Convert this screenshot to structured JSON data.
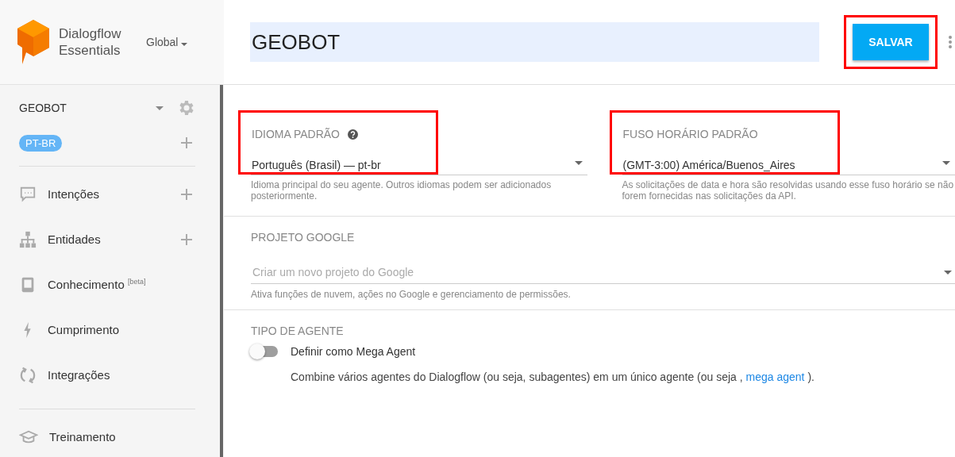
{
  "sidebar": {
    "logo": {
      "line1": "Dialogflow",
      "line2": "Essentials"
    },
    "region": "Global",
    "agent": "GEOBOT",
    "language": "PT-BR",
    "items": [
      {
        "label": "Intenções",
        "addable": true
      },
      {
        "label": "Entidades",
        "addable": true
      },
      {
        "label": "Conhecimento $^{[beta]}$",
        "addable": false
      },
      {
        "label": "Cumprimento",
        "addable": false
      },
      {
        "label": "Integrações",
        "addable": false
      }
    ],
    "training": "Treinamento"
  },
  "header": {
    "title": "GEOBOT",
    "save": "SALVAR"
  },
  "fields": [
    {
      "label": "IDIOMA PADRÃO",
      "help": true,
      "value": "Português (Brasil) — pt-br",
      "hint": "Idioma principal do seu agente. Outros idiomas podem ser adicionados posteriormente.",
      "highlighted": true
    },
    {
      "label": "FUSO HORÁRIO PADRÃO",
      "help": false,
      "value": "(GMT-3:00) América/Buenos_Aires",
      "hint": "As solicitações de data e hora são resolvidas usando esse fuso horário se não forem fornecidas nas solicitações da API.",
      "highlighted": true
    }
  ],
  "project": {
    "label": "PROJETO GOOGLE",
    "placeholder": "Criar um novo projeto do Google",
    "hint": "Ativa funções de nuvem, ações no Google e gerenciamento de permissões."
  },
  "agent_type": {
    "label": "TIPO DE AGENTE",
    "toggle_label": "Definir como Mega Agent",
    "on": false,
    "description": "Combine vários agentes do Dialogflow (ou seja, subagentes) em um único agente (ou seja ,",
    "link": "mega agent",
    "after": ")."
  }
}
